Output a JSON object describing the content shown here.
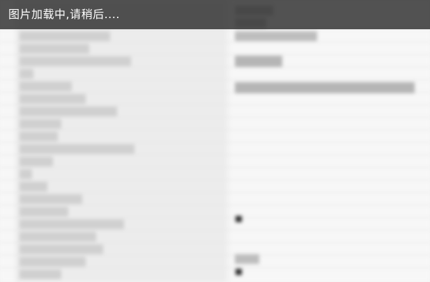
{
  "loading_banner": {
    "message": "图片加载中,请稍后...."
  }
}
